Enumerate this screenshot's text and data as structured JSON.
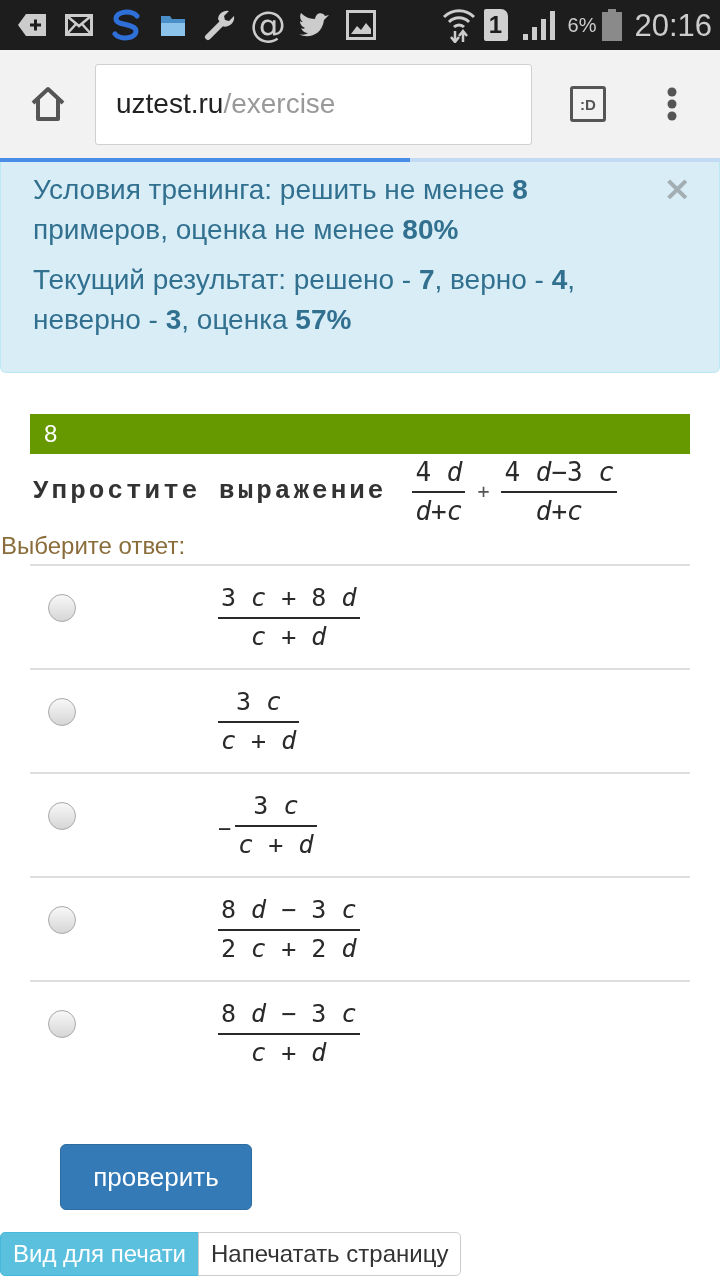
{
  "status_bar": {
    "notification_glyph": "@",
    "sim_slot": "1",
    "battery_percent": "6%",
    "time": "20:16"
  },
  "browser": {
    "url_host": "uztest.ru",
    "url_path": "/exercise",
    "tabs_button": ":D",
    "progress": {
      "level": 0.57
    }
  },
  "alert": {
    "lines": [
      "Условия тренинга: решить не менее **8** примеров, оценка не менее **80%**",
      "Текущий результат: решено - **7**, верно - **4**, неверно - **3**, оценка **57%**"
    ],
    "close": "×"
  },
  "question": {
    "number": "8",
    "prompt": "Упростите выражение",
    "expression": [
      {
        "kind": "fraction",
        "numerator": "4 *d*",
        "denominator": "*d*+*c*"
      },
      {
        "kind": "operator",
        "text": "+"
      },
      {
        "kind": "fraction",
        "numerator": "4 *d*−3 *c*",
        "denominator": "*d*+*c*"
      }
    ]
  },
  "answer_prompt": "Выберите ответ:",
  "answers": [
    {
      "selected": false,
      "numerator": "3 *c* + 8 *d*",
      "denominator": "*c* + *d*"
    },
    {
      "selected": false,
      "numerator": "3 *c*",
      "denominator": "*c* + *d*"
    },
    {
      "selected": false,
      "prefix": "−",
      "numerator": "3 *c*",
      "denominator": "*c* + *d*"
    },
    {
      "selected": false,
      "numerator": "8 *d* − 3 *c*",
      "denominator": "2 *c* + 2 *d*"
    },
    {
      "selected": false,
      "numerator": "8 *d* − 3 *c*",
      "denominator": "*c* + *d*"
    }
  ],
  "check_button": "проверить",
  "footer_buttons": [
    {
      "kind": "info",
      "label": "Вид для печати"
    },
    {
      "kind": "default",
      "label": "Напечатать страницу"
    }
  ]
}
